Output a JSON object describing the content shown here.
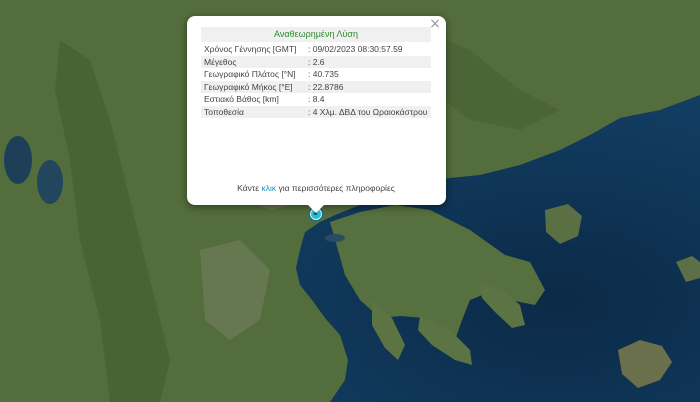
{
  "popup": {
    "title": "Αναθεωρημένη Λύση",
    "close_symbol": "×",
    "rows": [
      {
        "label": "Χρόνος Γέννησης [GMT]",
        "value": ": 09/02/2023 08:30:57.59"
      },
      {
        "label": "Μέγεθος",
        "value": ": 2.6"
      },
      {
        "label": "Γεωγραφικό Πλάτος [°N]",
        "value": ": 40.735"
      },
      {
        "label": "Γεωγραφικό Μήκος [°E]",
        "value": ": 22.8786"
      },
      {
        "label": "Εστιακό Βάθος [km]",
        "value": ": 8.4"
      },
      {
        "label": "Τοποθεσία",
        "value": ": 4 Χλμ. ΔΒΔ του Ωραιοκάστρου"
      }
    ],
    "more_prefix": "Κάντε",
    "more_link": "κλικ",
    "more_suffix": "για περισσότερες πληροφορίες"
  },
  "marker": {
    "icon": "earthquake-marker-icon",
    "color": "#26bfd2"
  },
  "map": {
    "land_color": "#4f6a3a",
    "sea_color": "#0f3250"
  }
}
